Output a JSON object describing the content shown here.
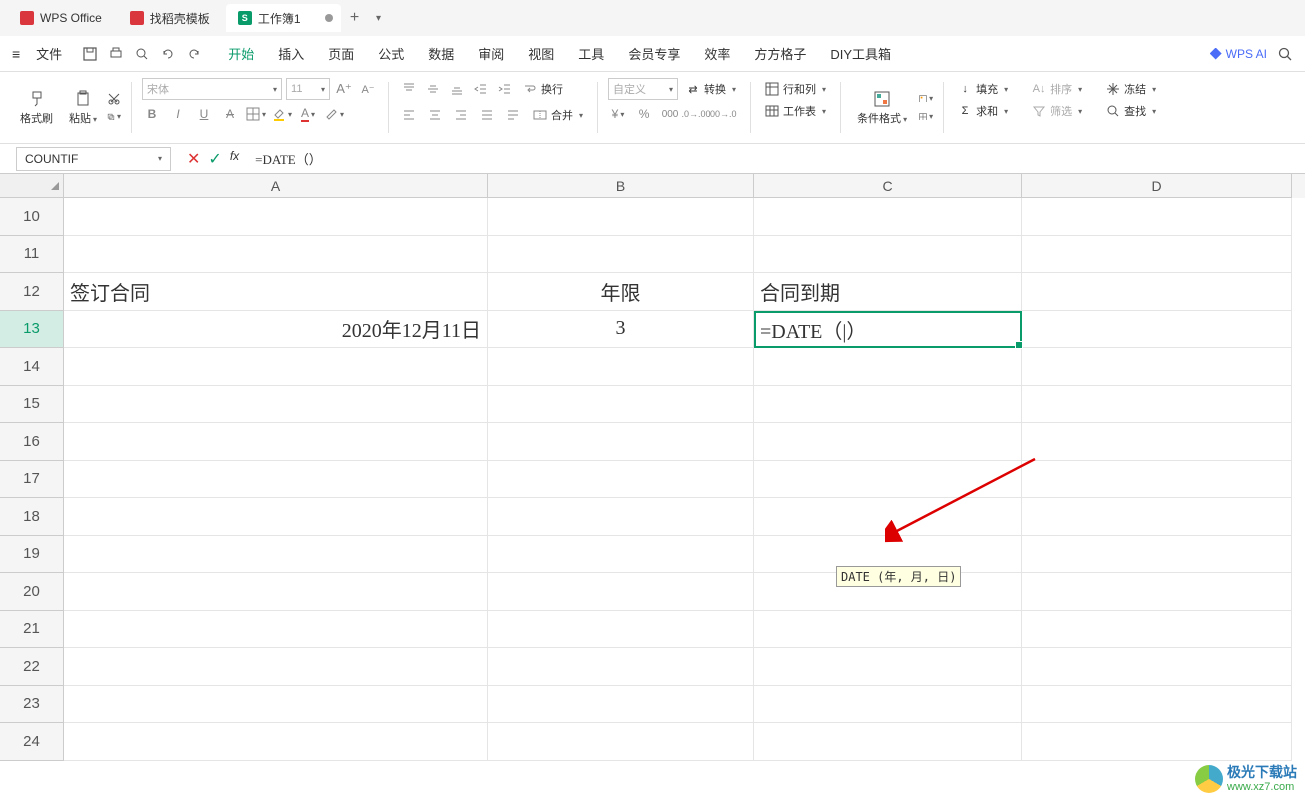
{
  "titlebar": {
    "tab1": "WPS Office",
    "tab2": "找稻壳模板",
    "tab3": "工作簿1",
    "s_letter": "S"
  },
  "menubar": {
    "file": "文件",
    "items": [
      "开始",
      "插入",
      "页面",
      "公式",
      "数据",
      "审阅",
      "视图",
      "工具",
      "会员专享",
      "效率",
      "方方格子",
      "DIY工具箱"
    ],
    "active_index": 0,
    "wpsai": "WPS AI"
  },
  "ribbon": {
    "format_painter": "格式刷",
    "paste": "粘贴",
    "font_name": "宋体",
    "font_size": "11",
    "wrap": "换行",
    "merge": "合并",
    "custom": "自定义",
    "convert": "转换",
    "rowcol": "行和列",
    "worksheet": "工作表",
    "cond_format": "条件格式",
    "fill": "填充",
    "sum": "求和",
    "sort": "排序",
    "filter": "筛选",
    "freeze": "冻结",
    "find": "查找"
  },
  "formula_bar": {
    "namebox": "COUNTIF",
    "formula": "=DATE（）"
  },
  "columns": [
    "A",
    "B",
    "C",
    "D"
  ],
  "row_start": 10,
  "row_end": 24,
  "active_row": 13,
  "cells": {
    "A12": "签订合同",
    "B12": "年限",
    "C12": "合同到期",
    "A13": "2020年12月11日",
    "B13": "3",
    "C13": "=DATE（|）"
  },
  "tooltip": "DATE (年, 月, 日)",
  "watermark": {
    "line1": "极光下载站",
    "line2": "www.xz7.com"
  }
}
